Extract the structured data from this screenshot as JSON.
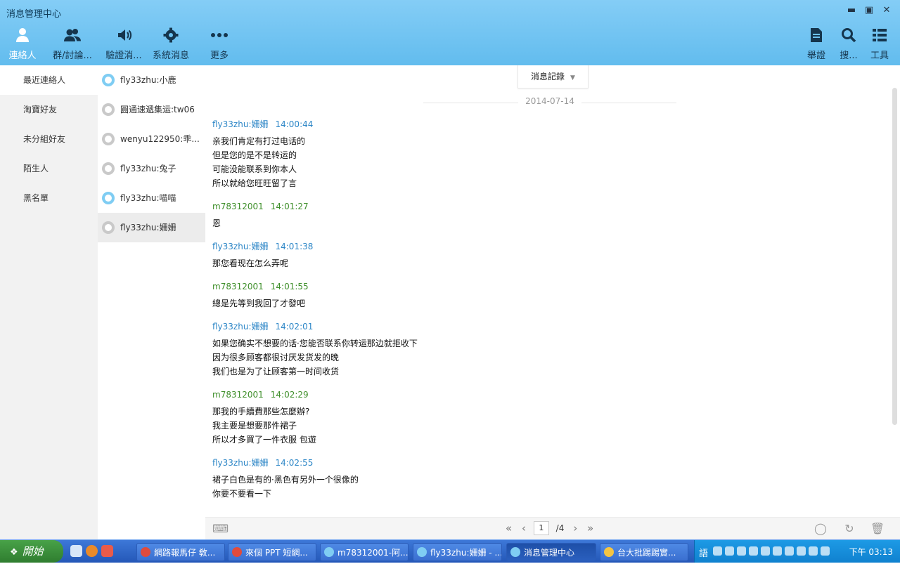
{
  "window": {
    "title": "消息管理中心"
  },
  "toolbar": {
    "left": [
      {
        "id": "contacts",
        "label": "連絡人",
        "icon": "person-icon"
      },
      {
        "id": "groups",
        "label": "群/討論...",
        "icon": "group-icon"
      },
      {
        "id": "verify",
        "label": "驗證消...",
        "icon": "speaker-icon"
      },
      {
        "id": "system",
        "label": "系統消息",
        "icon": "gear-icon"
      },
      {
        "id": "more",
        "label": "更多",
        "icon": "more-icon"
      }
    ],
    "right": [
      {
        "id": "report",
        "label": "舉證",
        "icon": "document-icon"
      },
      {
        "id": "search",
        "label": "搜...",
        "icon": "search-icon"
      },
      {
        "id": "tools",
        "label": "工具",
        "icon": "list-icon"
      }
    ]
  },
  "categories": [
    "最近連絡人",
    "淘寶好友",
    "未分組好友",
    "陌生人",
    "黑名單"
  ],
  "contacts": [
    {
      "name": "fly33zhu:小鹿",
      "online": true
    },
    {
      "name": "圓通速遞集运:tw06",
      "online": false
    },
    {
      "name": "wenyu122950:乖...",
      "online": false
    },
    {
      "name": "fly33zhu:兔子",
      "online": false
    },
    {
      "name": "fly33zhu:喵喵",
      "online": true
    },
    {
      "name": "fly33zhu:姍姍",
      "online": false
    }
  ],
  "chat": {
    "record_label": "消息記錄",
    "date": "2014-07-14",
    "messages": [
      {
        "sender": "fly33zhu:姍姍",
        "time": "14:00:44",
        "side": "them",
        "lines": [
          "亲我们肯定有打过电话的",
          "但是您的是不是转运的",
          "可能没能联系到你本人",
          "所以就给您旺旺留了言"
        ]
      },
      {
        "sender": "m78312001",
        "time": "14:01:27",
        "side": "me",
        "lines": [
          "恩"
        ]
      },
      {
        "sender": "fly33zhu:姍姍",
        "time": "14:01:38",
        "side": "them",
        "lines": [
          "那您看现在怎么弄呢"
        ]
      },
      {
        "sender": "m78312001",
        "time": "14:01:55",
        "side": "me",
        "lines": [
          "總是先等到我回了才發吧"
        ]
      },
      {
        "sender": "fly33zhu:姍姍",
        "time": "14:02:01",
        "side": "them",
        "lines": [
          "如果您确实不想要的话·您能否联系你转运那边就拒收下",
          "因为很多顾客都很讨厌发货发的晚",
          "我们也是为了让顾客第一时间收货"
        ]
      },
      {
        "sender": "m78312001",
        "time": "14:02:29",
        "side": "me",
        "lines": [
          "那我的手續費那些怎麼辦?",
          "我主要是想要那件裙子",
          "所以才多買了一件衣服  包遊"
        ]
      },
      {
        "sender": "fly33zhu:姍姍",
        "time": "14:02:55",
        "side": "them",
        "lines": [
          "裙子白色是有的·黑色有另外一个很像的",
          "你要不要看一下"
        ]
      }
    ]
  },
  "pager": {
    "current": "1",
    "total": "/4"
  },
  "taskbar": {
    "start_label": "開始",
    "tasks": [
      {
        "label": "網路報馬仔 敎...",
        "color": "#e04b3c",
        "active": false
      },
      {
        "label": "來個 PPT 短網...",
        "color": "#e04b3c",
        "active": false
      },
      {
        "label": "m78312001-阿...",
        "color": "#7fcdf3",
        "active": false
      },
      {
        "label": "fly33zhu:姍姍 - ...",
        "color": "#7fcdf3",
        "active": false
      },
      {
        "label": "消息管理中心",
        "color": "#7fcdf3",
        "active": true
      },
      {
        "label": "台大批踢踢實...",
        "color": "#f5c542",
        "active": false
      }
    ],
    "ime": "語",
    "clock": "下午 03:13"
  }
}
